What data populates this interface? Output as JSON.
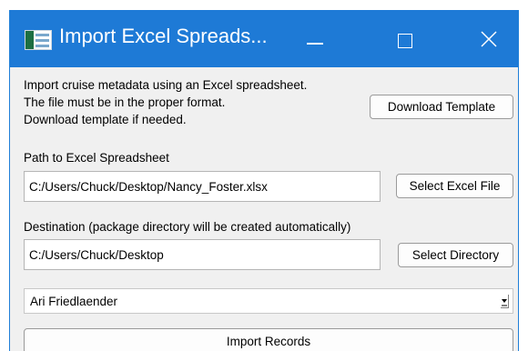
{
  "window": {
    "title": "Import Excel Spreads...",
    "icons": {
      "app": "excel-icon",
      "minimize": "minimize-icon",
      "maximize": "maximize-icon",
      "close": "close-icon"
    }
  },
  "intro": {
    "line1": "Import cruise metadata using an Excel spreadsheet.",
    "line2": "The file must be in the proper format.",
    "line3": "Download template if needed."
  },
  "buttons": {
    "download_template": "Download Template",
    "select_excel_file": "Select Excel File",
    "select_directory": "Select Directory",
    "import_records": "Import Records"
  },
  "path_section": {
    "label": "Path to Excel Spreadsheet",
    "value": "C:/Users/Chuck/Desktop/Nancy_Foster.xlsx"
  },
  "destination_section": {
    "label": "Destination (package directory will be created automatically)",
    "value": "C:/Users/Chuck/Desktop"
  },
  "person_select": {
    "selected": "Ari Friedlaender"
  },
  "colors": {
    "titlebar": "#1e7ad6",
    "window_bg": "#f0f0f0"
  }
}
